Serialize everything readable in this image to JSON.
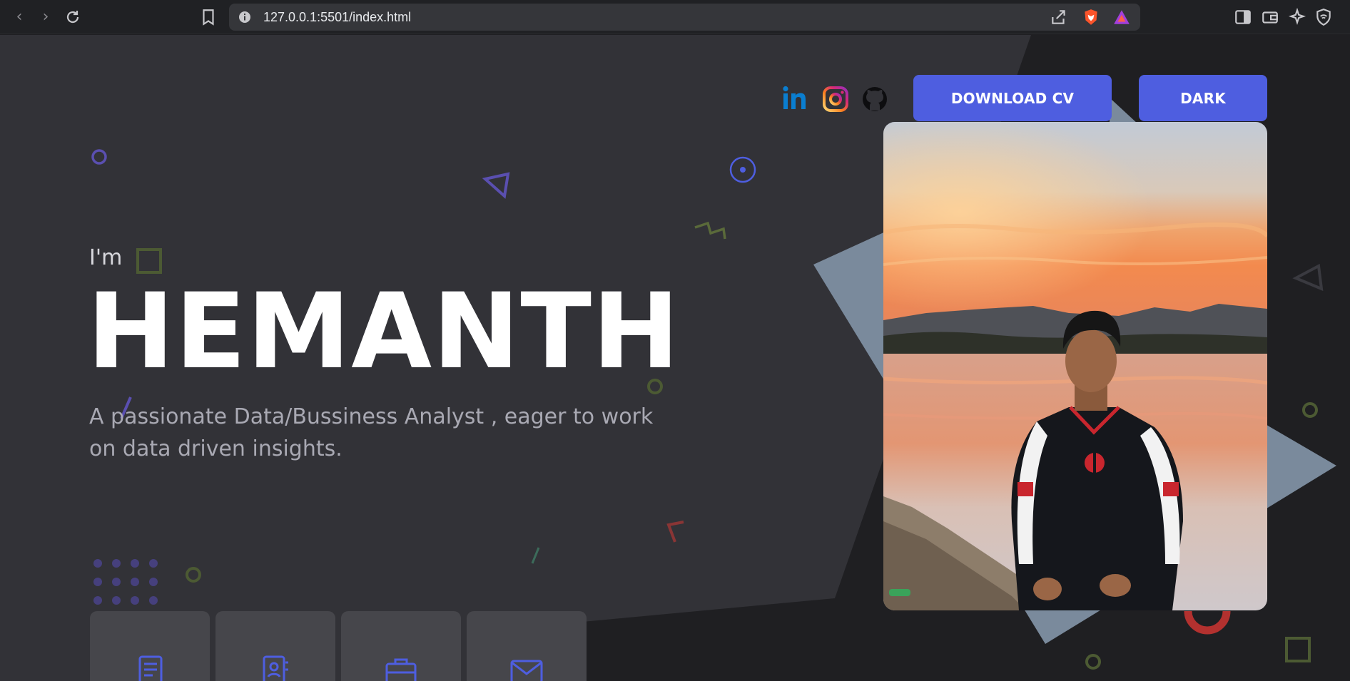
{
  "browser": {
    "url": "127.0.0.1:5501/index.html"
  },
  "hero": {
    "intro": "I'm",
    "name": "HEMANTH",
    "tagline": "A passionate Data/Bussiness Analyst , eager to work on data driven insights."
  },
  "header": {
    "download_cv_label": "DOWNLOAD CV",
    "theme_label": "DARK",
    "social_links": [
      "linkedin-icon",
      "instagram-icon",
      "github-icon"
    ]
  },
  "cards": [
    {
      "icon": "document-icon"
    },
    {
      "icon": "contact-book-icon"
    },
    {
      "icon": "briefcase-icon"
    },
    {
      "icon": "mail-icon"
    }
  ],
  "colors": {
    "accent": "#4e5ee0",
    "page_bg": "#323237",
    "dark_bg": "#1f1f22",
    "slate": "#7a8a9c"
  }
}
